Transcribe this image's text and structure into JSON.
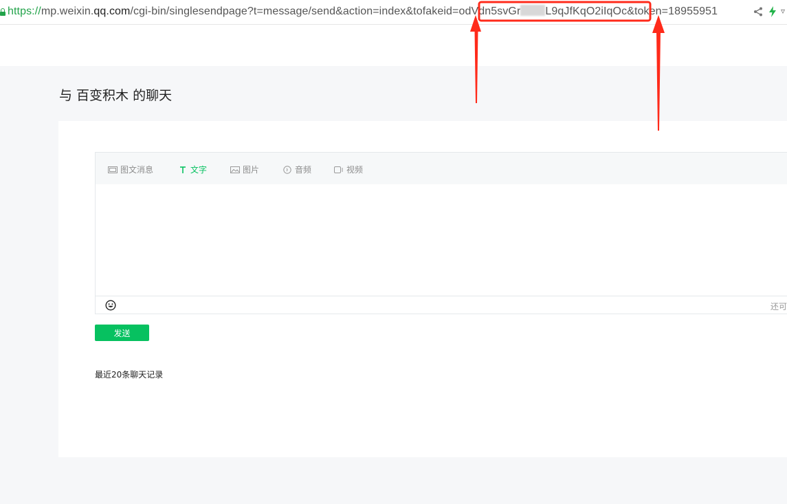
{
  "browser": {
    "url_scheme": "https://",
    "url_host_prefix": "mp.weixin.",
    "url_host_bold": "qq.com",
    "url_path": "/cgi-bin/singlesendpage?t=message/send&action=index&tofakeid=",
    "url_fakeid_start": "odVdn5svGr",
    "url_fakeid_end": "L9qJfKqO2iIqOc",
    "url_tail": "&token=18955951",
    "icons": [
      "lock-icon",
      "share-icon",
      "bolt-icon",
      "chevron-down-icon"
    ],
    "accent_color": "#22a34a"
  },
  "annotation": {
    "highlight_color": "#ff2a1a"
  },
  "page": {
    "title": "与 百变积木 的聊天"
  },
  "editor": {
    "tabs": [
      {
        "label": "图文消息",
        "icon": "news-icon",
        "active": false
      },
      {
        "label": "文字",
        "icon": "text-icon",
        "active": true
      },
      {
        "label": "图片",
        "icon": "image-icon",
        "active": false
      },
      {
        "label": "音频",
        "icon": "audio-icon",
        "active": false
      },
      {
        "label": "视频",
        "icon": "video-icon",
        "active": false
      }
    ],
    "text_value": "",
    "remaining_label": "还可",
    "emoji_icon": "emoji-icon"
  },
  "actions": {
    "send_label": "发送",
    "send_color": "#07c160"
  },
  "history": {
    "title": "最近20条聊天记录"
  }
}
